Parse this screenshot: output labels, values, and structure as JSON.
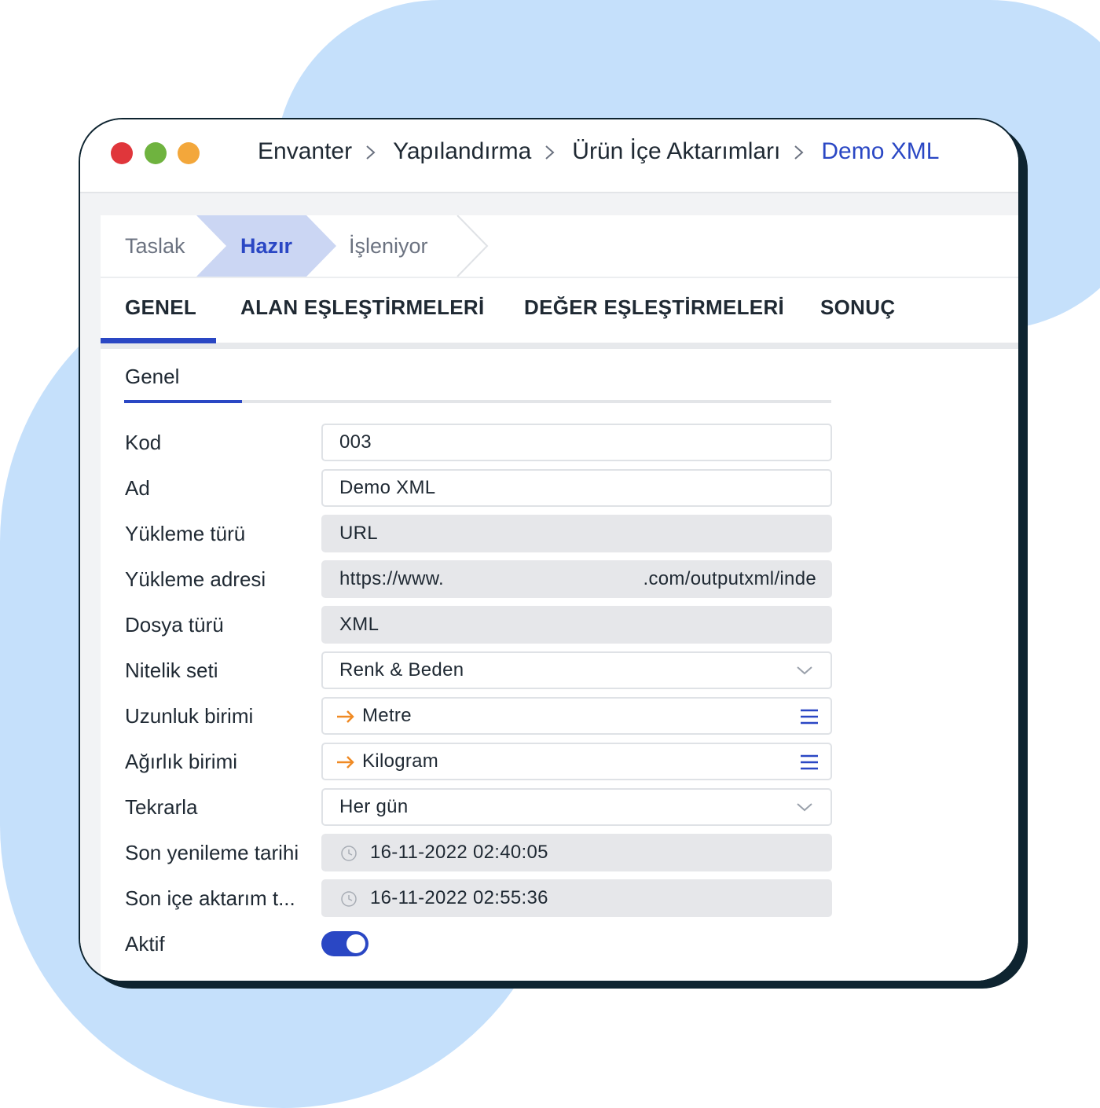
{
  "breadcrumb": {
    "items": [
      "Envanter",
      "Yapılandırma",
      "Ürün İçe Aktarımları"
    ],
    "current": "Demo XML"
  },
  "status_steps": {
    "items": [
      "Taslak",
      "Hazır",
      "İşleniyor"
    ],
    "active": "Hazır"
  },
  "tabs": {
    "items": [
      "GENEL",
      "ALAN EŞLEŞTİRMELERİ",
      "DEĞER EŞLEŞTİRMELERİ",
      "SONUÇ"
    ],
    "active": "GENEL"
  },
  "section": {
    "title": "Genel"
  },
  "form": {
    "kod": {
      "label": "Kod",
      "value": "003"
    },
    "ad": {
      "label": "Ad",
      "value": "Demo XML"
    },
    "yukleme_turu": {
      "label": "Yükleme türü",
      "value": "URL"
    },
    "yukleme_adresi": {
      "label": "Yükleme adresi",
      "value_start": "https://www.",
      "value_end": ".com/outputxml/inde"
    },
    "dosya_turu": {
      "label": "Dosya türü",
      "value": "XML"
    },
    "nitelik_seti": {
      "label": "Nitelik seti",
      "value": "Renk & Beden"
    },
    "uzunluk_birimi": {
      "label": "Uzunluk birimi",
      "value": "Metre"
    },
    "agirlik_birimi": {
      "label": "Ağırlık birimi",
      "value": "Kilogram"
    },
    "tekrarla": {
      "label": "Tekrarla",
      "value": "Her gün"
    },
    "son_yenileme": {
      "label": "Son yenileme tarihi",
      "value": "16-11-2022 02:40:05"
    },
    "son_ice_aktarim": {
      "label": "Son içe aktarım t...",
      "value": "16-11-2022 02:55:36"
    },
    "aktif": {
      "label": "Aktif",
      "on": true
    }
  },
  "colors": {
    "accent": "#2a47c4",
    "arrow": "#f08a24",
    "background_blob": "#c5e0fb",
    "dot_red": "#e0363b",
    "dot_green": "#6fb33f",
    "dot_yellow": "#f3a73b"
  }
}
